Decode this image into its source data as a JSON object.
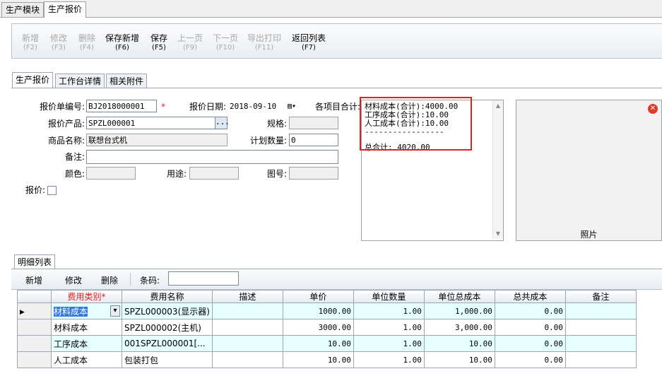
{
  "top_tabs": [
    "生产模块",
    "生产报价"
  ],
  "toolbar": [
    {
      "label": "新增",
      "key": "(F2)",
      "enabled": false
    },
    {
      "label": "修改",
      "key": "(F3)",
      "enabled": false
    },
    {
      "label": "删除",
      "key": "(F4)",
      "enabled": false
    },
    {
      "label": "保存新增",
      "key": "(F6)",
      "enabled": true
    },
    {
      "label": "保存",
      "key": "(F5)",
      "enabled": true
    },
    {
      "label": "上一页",
      "key": "(F9)",
      "enabled": false
    },
    {
      "label": "下一页",
      "key": "(F10)",
      "enabled": false
    },
    {
      "label": "导出打印",
      "key": "(F11)",
      "enabled": false
    },
    {
      "label": "返回列表",
      "key": "(F7)",
      "enabled": true
    }
  ],
  "section_tabs": [
    "生产报价",
    "工作台详情",
    "相关附件"
  ],
  "form": {
    "order_no_label": "报价单编号:",
    "order_no": "BJ2018000001",
    "required_mark": "*",
    "date_label": "报价日期:",
    "date": "2018-09-10",
    "sum_label": "各项目合计:",
    "product_label": "报价产品:",
    "product": "SPZL000001",
    "lookup": "...",
    "spec_label": "规格:",
    "spec": "",
    "name_label": "商品名称:",
    "name": "联想台式机",
    "qty_label": "计划数量:",
    "qty": "0",
    "remark_label": "备注:",
    "remark": "",
    "color_label": "颜色:",
    "color": "",
    "use_label": "用途:",
    "use": "",
    "drawing_label": "图号:",
    "drawing": "",
    "quoted_label": "报价:"
  },
  "summary": {
    "lines": [
      "材料成本(合计):4000.00",
      "工序成本(合计):10.00",
      "人工成本(合计):10.00",
      "-----------------",
      "",
      "总合计: 4020.00"
    ]
  },
  "photo": {
    "label": "照片"
  },
  "detail": {
    "tab": "明细列表",
    "add": "新增",
    "edit": "修改",
    "delete": "删除",
    "barcode_label": "条码:",
    "barcode": "",
    "columns": [
      "费用类别*",
      "费用名称",
      "描述",
      "单价",
      "单位数量",
      "单位总成本",
      "总共成本",
      "备注"
    ],
    "rows": [
      [
        "材料成本",
        "SPZL000003(显示器)",
        "",
        "1000.00",
        "1.00",
        "1,000.00",
        "0.00",
        ""
      ],
      [
        "材料成本",
        "SPZL000002(主机)",
        "",
        "3000.00",
        "1.00",
        "3,000.00",
        "0.00",
        ""
      ],
      [
        "工序成本",
        "001SPZL000001[...",
        "",
        "10.00",
        "1.00",
        "10.00",
        "0.00",
        ""
      ],
      [
        "人工成本",
        "包装打包",
        "",
        "10.00",
        "1.00",
        "10.00",
        "0.00",
        ""
      ]
    ]
  }
}
